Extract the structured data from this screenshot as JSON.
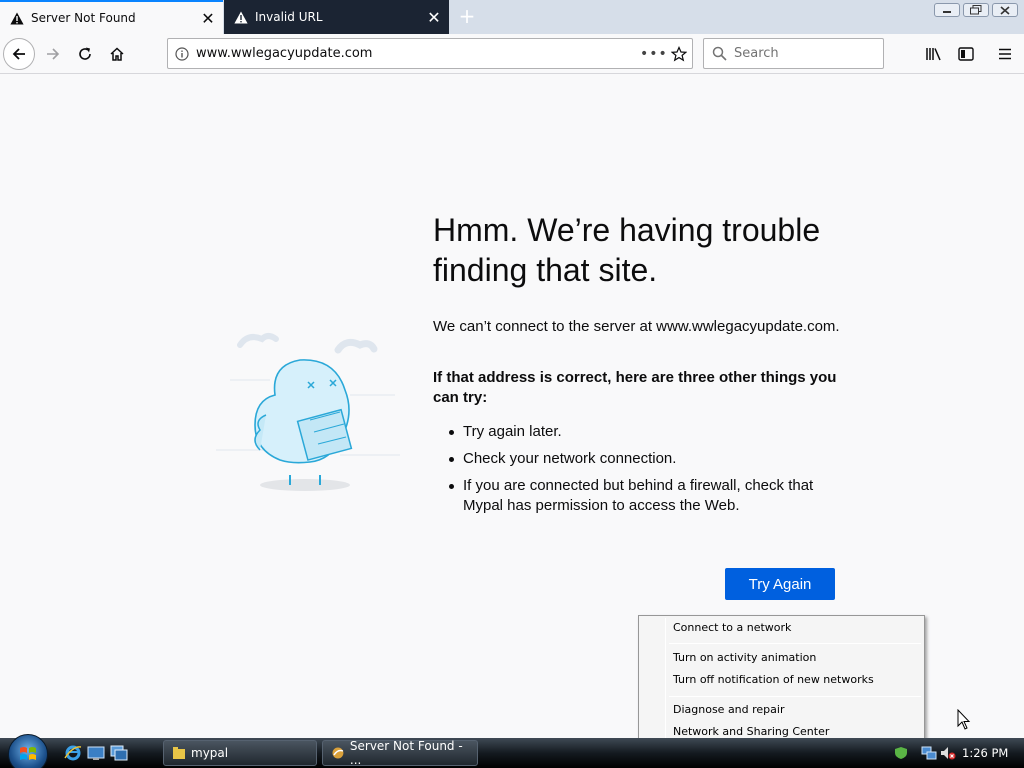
{
  "browser": {
    "tabs": [
      {
        "label": "Server Not Found",
        "active": true
      },
      {
        "label": "Invalid URL",
        "active": false
      }
    ],
    "url": "www.wwlegacyupdate.com",
    "search_placeholder": "Search"
  },
  "error_page": {
    "title_line1": "Hmm. We’re having trouble",
    "title_line2": "finding that site.",
    "description": "We can’t connect to the server at www.wwlegacyupdate.com.",
    "subhead_line1": "If that address is correct, here are three other things you",
    "subhead_line2": "can try:",
    "tips": [
      "Try again later.",
      "Check your network connection.",
      "If you are connected but behind a firewall, check that Mypal has permission to access the Web."
    ],
    "button_label": "Try Again"
  },
  "context_menu": {
    "items": [
      "Connect to a network",
      "Turn on activity animation",
      "Turn off notification of new networks",
      "Diagnose and repair",
      "Network and Sharing Center"
    ]
  },
  "taskbar": {
    "buttons": [
      "mypal",
      "Server Not Found - ..."
    ],
    "clock": "1:26 PM"
  },
  "colors": {
    "accent": "#0a84ff",
    "button_blue": "#0060df",
    "dark_tab": "#1b2433"
  }
}
